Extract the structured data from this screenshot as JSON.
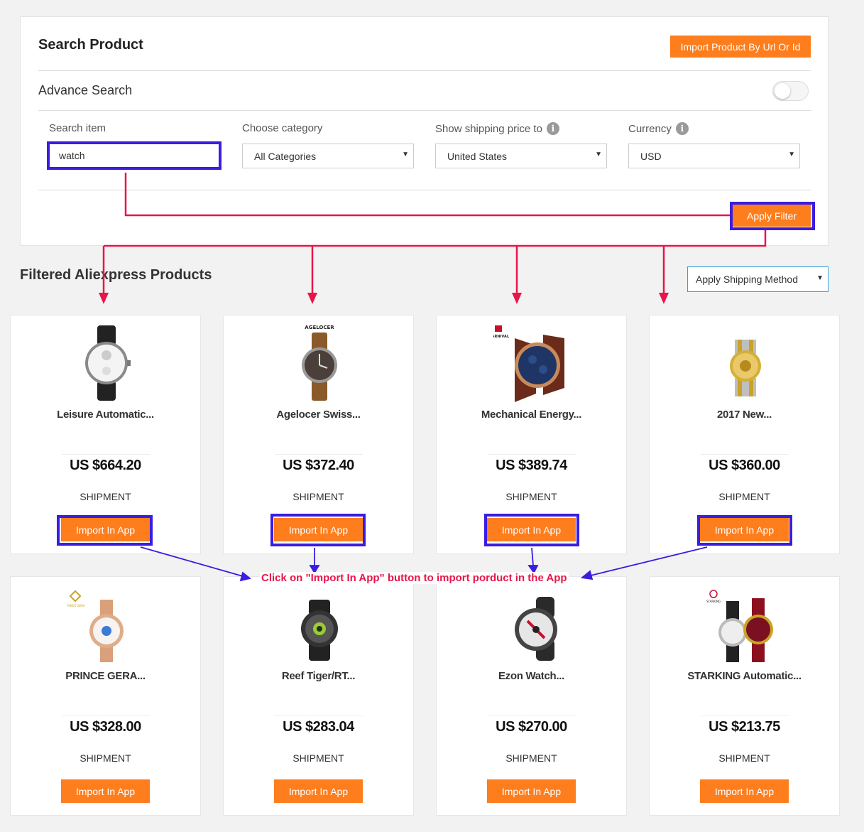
{
  "search_panel": {
    "title": "Search Product",
    "import_button": "Import Product By Url Or Id",
    "advance_search_label": "Advance Search",
    "advance_search_on": false,
    "fields": {
      "search_label": "Search item",
      "search_value": "watch",
      "category_label": "Choose category",
      "category_value": "All Categories",
      "shipping_label": "Show shipping price to",
      "shipping_value": "United States",
      "currency_label": "Currency",
      "currency_value": "USD"
    },
    "apply_filter": "Apply Filter"
  },
  "results": {
    "title": "Filtered Aliexpress Products",
    "shipping_method": "Apply Shipping Method",
    "products": [
      {
        "name": "Leisure Automatic...",
        "price": "US $664.20",
        "shipment": "SHIPMENT",
        "button": "Import In App"
      },
      {
        "name": "Agelocer Swiss...",
        "price": "US $372.40",
        "shipment": "SHIPMENT",
        "button": "Import In App",
        "brand_mark": "AGELOCER"
      },
      {
        "name": "Mechanical Energy...",
        "price": "US $389.74",
        "shipment": "SHIPMENT",
        "button": "Import In App",
        "brand_mark": "CARNIVAL"
      },
      {
        "name": "2017 New...",
        "price": "US $360.00",
        "shipment": "SHIPMENT",
        "button": "Import In App"
      },
      {
        "name": "PRINCE GERA...",
        "price": "US $328.00",
        "shipment": "SHIPMENT",
        "button": "Import In App",
        "brand_mark": "PRINCE GERA"
      },
      {
        "name": "Reef Tiger/RT...",
        "price": "US $283.04",
        "shipment": "SHIPMENT",
        "button": "Import In App"
      },
      {
        "name": "Ezon Watch...",
        "price": "US $270.00",
        "shipment": "SHIPMENT",
        "button": "Import In App"
      },
      {
        "name": "STARKING Automatic...",
        "price": "US $213.75",
        "shipment": "SHIPMENT",
        "button": "Import In App",
        "brand_mark": "STARKING"
      }
    ]
  },
  "annotation": {
    "note": "Click on \"Import In App\" button to import porduct in the App",
    "colors": {
      "arrow_red": "#e8154a",
      "arrow_blue": "#3a1de0",
      "button_orange": "#fe7d1d"
    }
  }
}
